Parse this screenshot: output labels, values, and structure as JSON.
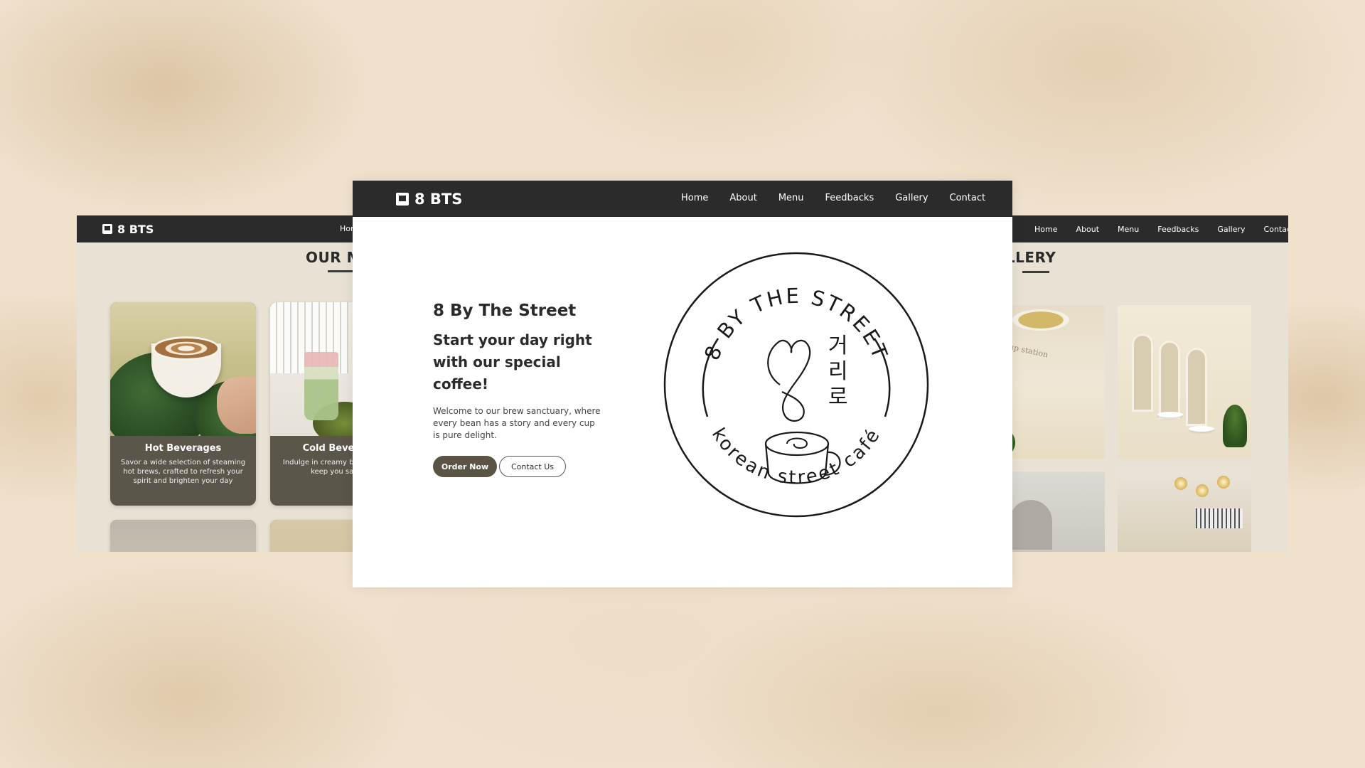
{
  "brand": "8 BTS",
  "nav_items": [
    "Home",
    "About",
    "Menu",
    "Feedbacks",
    "Gallery",
    "Contact"
  ],
  "left_panel": {
    "nav_items": [
      "Home"
    ],
    "section_title": "OUR MENU",
    "cards": [
      {
        "title": "Hot Beverages",
        "desc": "Savor a wide selection of steaming hot brews, crafted to refresh your spirit and brighten your day"
      },
      {
        "title": "Cold Beverages",
        "desc": "Indulge in creamy beverages that keep you satisfied"
      }
    ]
  },
  "right_panel": {
    "section_title": "GALLERY",
    "pickup_sign": "pick-up station"
  },
  "hero": {
    "name": "8 By The Street",
    "tagline": "Start your day right with our special coffee!",
    "description": "Welcome to our brew sanctuary, where every bean has a story and every cup is pure delight.",
    "order_button": "Order Now",
    "contact_button": "Contact Us"
  },
  "logo": {
    "top_text": "8 BY THE STREET",
    "bottom_text": "korean street café",
    "korean_chars": [
      "거",
      "리",
      "로"
    ]
  },
  "colors": {
    "nav_bg": "#2b2b2b",
    "button_dark": "#5b5446",
    "panel_bg": "#e8e2d4",
    "page_bg": "#efe1cc"
  }
}
